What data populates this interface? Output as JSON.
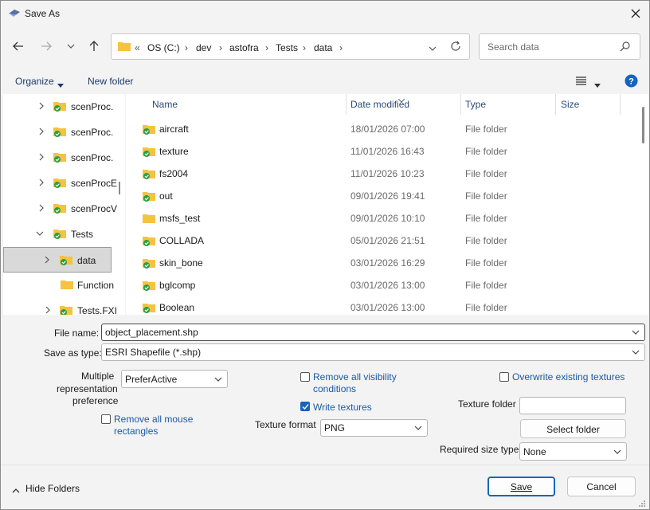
{
  "window": {
    "title": "Save As"
  },
  "address": {
    "crumbs": [
      "OS (C:)",
      "dev",
      "astofra",
      "Tests",
      "data"
    ],
    "overflow": "«"
  },
  "search": {
    "placeholder": "Search data"
  },
  "toolbar": {
    "organize": "Organize",
    "new_folder": "New folder"
  },
  "tree": [
    {
      "label": "scenProc."
    },
    {
      "label": "scenProc."
    },
    {
      "label": "scenProc."
    },
    {
      "label": "scenProcE"
    },
    {
      "label": "scenProcV"
    },
    {
      "label": "Tests"
    },
    {
      "label": "data"
    },
    {
      "label": "Function"
    },
    {
      "label": "Tests.FXI"
    }
  ],
  "columns": {
    "name": "Name",
    "date": "Date modified",
    "type": "Type",
    "size": "Size"
  },
  "files": [
    {
      "name": "aircraft",
      "date": "18/01/2026 07:00",
      "type": "File folder"
    },
    {
      "name": "texture",
      "date": "11/01/2026 16:43",
      "type": "File folder"
    },
    {
      "name": "fs2004",
      "date": "11/01/2026 10:23",
      "type": "File folder"
    },
    {
      "name": "out",
      "date": "09/01/2026 19:41",
      "type": "File folder"
    },
    {
      "name": "msfs_test",
      "date": "09/01/2026 10:10",
      "type": "File folder"
    },
    {
      "name": "COLLADA",
      "date": "05/01/2026 21:51",
      "type": "File folder"
    },
    {
      "name": "skin_bone",
      "date": "03/01/2026 16:29",
      "type": "File folder"
    },
    {
      "name": "bglcomp",
      "date": "03/01/2026 13:00",
      "type": "File folder"
    },
    {
      "name": "Boolean",
      "date": "03/01/2026 13:00",
      "type": "File folder"
    }
  ],
  "form": {
    "file_name_label": "File name:",
    "file_name_value": "object_placement.shp",
    "save_type_label": "Save as type:",
    "save_type_value": "ESRI Shapefile (*.shp)",
    "multi_label_1": "Multiple",
    "multi_label_2": "representation",
    "multi_label_3": "preference",
    "multi_value": "PreferActive",
    "remove_mouse_1": "Remove all mouse",
    "remove_mouse_2": "rectangles",
    "remove_vis_1": "Remove all visibility",
    "remove_vis_2": "conditions",
    "write_textures": "Write textures",
    "texture_format_label": "Texture format",
    "texture_format_value": "PNG",
    "overwrite": "Overwrite existing textures",
    "texture_folder_label": "Texture folder",
    "texture_folder_value": "",
    "select_folder": "Select folder",
    "required_size_label": "Required size type",
    "required_size_value": "None"
  },
  "footer": {
    "hide_folders": "Hide Folders",
    "save": "Save",
    "cancel": "Cancel"
  },
  "colors": {
    "accent": "#1664c0",
    "folder": "#f5c242",
    "check": "#2aa040"
  }
}
